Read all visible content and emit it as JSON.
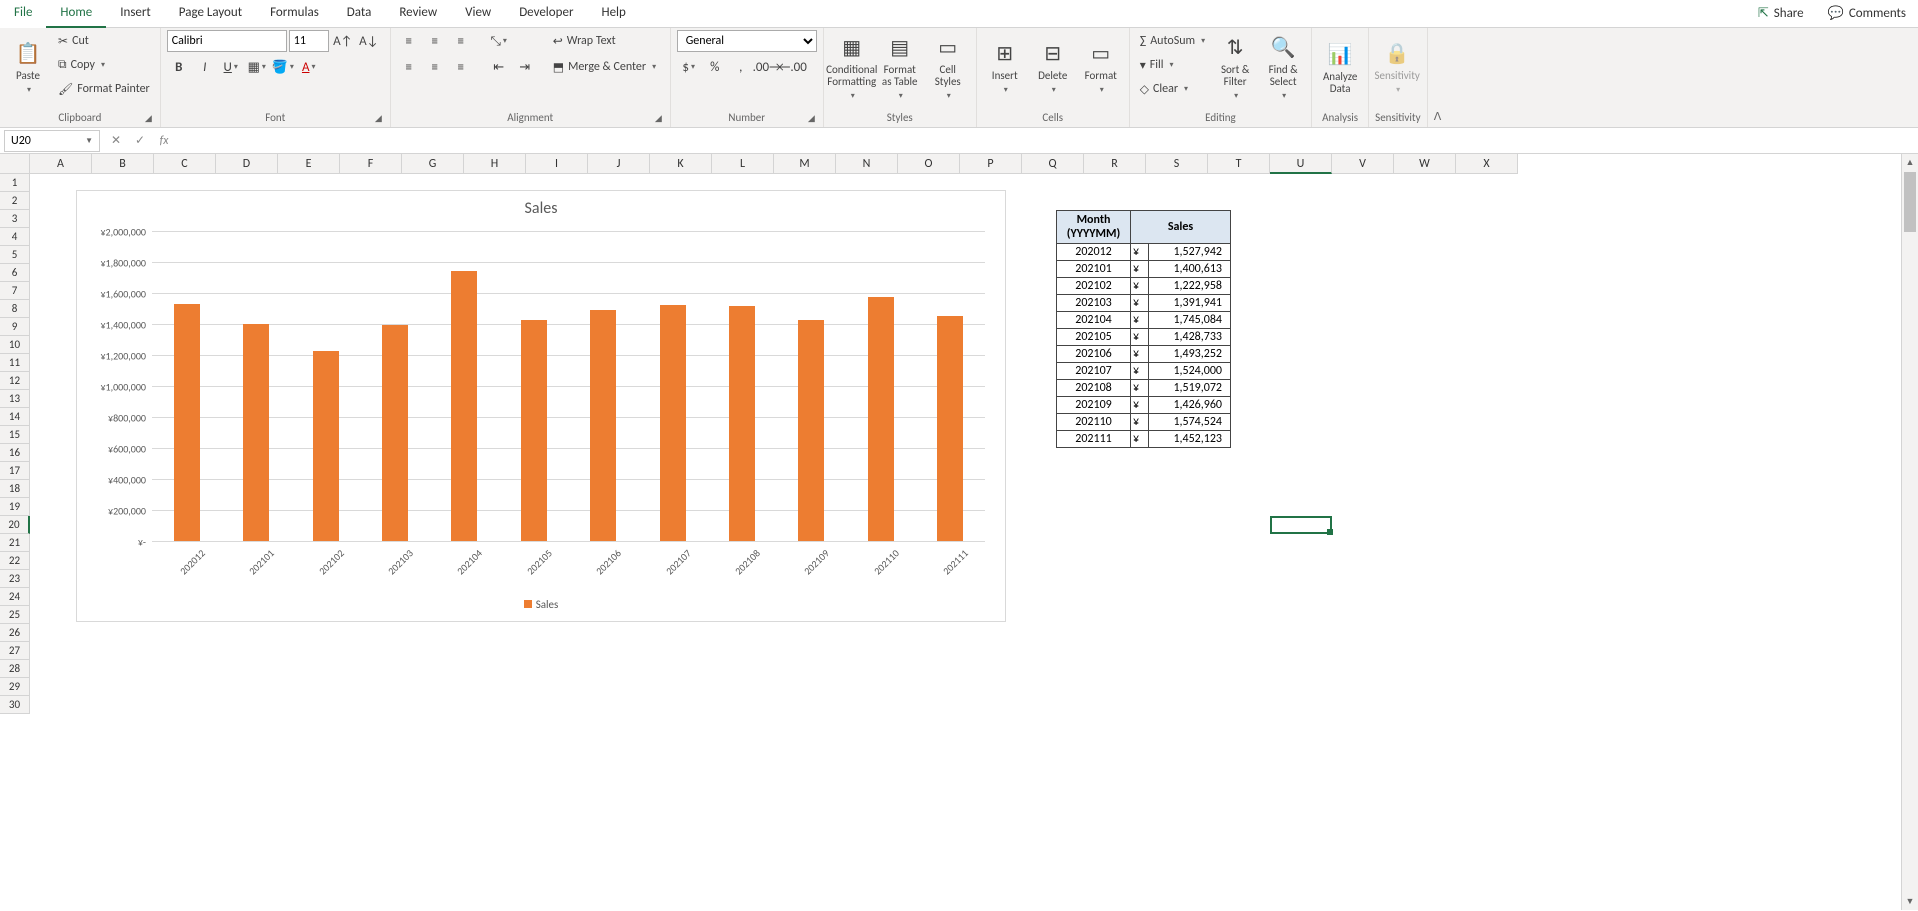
{
  "tabs": [
    "File",
    "Home",
    "Insert",
    "Page Layout",
    "Formulas",
    "Data",
    "Review",
    "View",
    "Developer",
    "Help"
  ],
  "active_tab": "Home",
  "share": "Share",
  "comments": "Comments",
  "clipboard": {
    "paste": "Paste",
    "cut": "Cut",
    "copy": "Copy",
    "fp": "Format Painter",
    "label": "Clipboard"
  },
  "font": {
    "name": "Calibri",
    "size": "11",
    "label": "Font"
  },
  "alignment": {
    "wrap": "Wrap Text",
    "merge": "Merge & Center",
    "label": "Alignment"
  },
  "number": {
    "format": "General",
    "label": "Number"
  },
  "styles": {
    "cf": "Conditional Formatting",
    "fat": "Format as Table",
    "cs": "Cell Styles",
    "label": "Styles"
  },
  "cells": {
    "ins": "Insert",
    "del": "Delete",
    "fmt": "Format",
    "label": "Cells"
  },
  "editing": {
    "sum": "AutoSum",
    "fill": "Fill",
    "clear": "Clear",
    "sort": "Sort & Filter",
    "find": "Find & Select",
    "label": "Editing"
  },
  "analysis": {
    "ad": "Analyze Data",
    "label": "Analysis"
  },
  "sensitivity": {
    "s": "Sensitivity",
    "label": "Sensitivity"
  },
  "name_box": "U20",
  "columns": [
    "A",
    "B",
    "C",
    "D",
    "E",
    "F",
    "G",
    "H",
    "I",
    "J",
    "K",
    "L",
    "M",
    "N",
    "O",
    "P",
    "Q",
    "R",
    "S",
    "T",
    "U",
    "V",
    "W",
    "X"
  ],
  "active_col": "U",
  "active_row": 20,
  "chart_data": {
    "type": "bar",
    "title": "Sales",
    "categories": [
      "202012",
      "202101",
      "202102",
      "202103",
      "202104",
      "202105",
      "202106",
      "202107",
      "202108",
      "202109",
      "202110",
      "202111"
    ],
    "values": [
      1527942,
      1400613,
      1222958,
      1391941,
      1745084,
      1428733,
      1493252,
      1524000,
      1519072,
      1426960,
      1574524,
      1452123
    ],
    "ylim": [
      0,
      2000000
    ],
    "y_ticks": [
      "¥-",
      "¥200,000",
      "¥400,000",
      "¥600,000",
      "¥800,000",
      "¥1,000,000",
      "¥1,200,000",
      "¥1,400,000",
      "¥1,600,000",
      "¥1,800,000",
      "¥2,000,000"
    ],
    "legend": "Sales"
  },
  "table": {
    "headers": [
      "Month (YYYYMM)",
      "Sales"
    ],
    "currency": "¥",
    "rows": [
      {
        "m": "202012",
        "v": "1,527,942"
      },
      {
        "m": "202101",
        "v": "1,400,613"
      },
      {
        "m": "202102",
        "v": "1,222,958"
      },
      {
        "m": "202103",
        "v": "1,391,941"
      },
      {
        "m": "202104",
        "v": "1,745,084"
      },
      {
        "m": "202105",
        "v": "1,428,733"
      },
      {
        "m": "202106",
        "v": "1,493,252"
      },
      {
        "m": "202107",
        "v": "1,524,000"
      },
      {
        "m": "202108",
        "v": "1,519,072"
      },
      {
        "m": "202109",
        "v": "1,426,960"
      },
      {
        "m": "202110",
        "v": "1,574,524"
      },
      {
        "m": "202111",
        "v": "1,452,123"
      }
    ]
  }
}
